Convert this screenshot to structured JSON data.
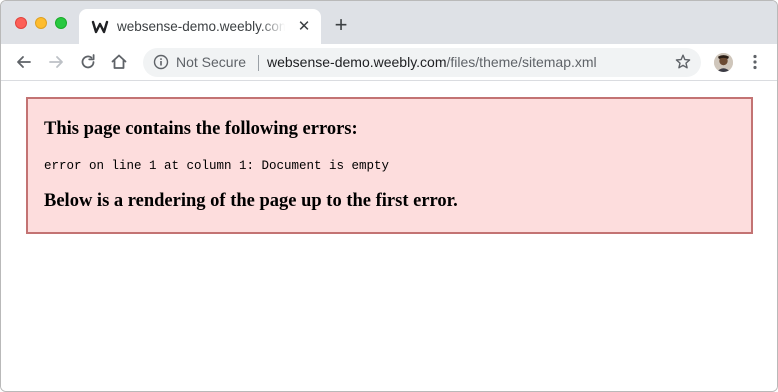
{
  "colors": {
    "tabstrip_bg": "#dee1e6",
    "close_red": "#fd5f57",
    "minimize_yellow": "#febc2e",
    "maximize_green": "#28c840",
    "error_box_bg": "#fddddd",
    "error_box_border": "#c37373"
  },
  "tab": {
    "favicon": "weebly-w-icon",
    "title": "websense-demo.weebly.com/files/theme/sitemap.xml",
    "close_glyph": "✕"
  },
  "new_tab_glyph": "+",
  "toolbar": {
    "back_icon": "back-arrow-icon",
    "forward_icon": "forward-arrow-icon",
    "reload_icon": "reload-icon",
    "home_icon": "home-icon"
  },
  "omnibox": {
    "security_label": "Not Secure",
    "url_host": "websense-demo.weebly.com",
    "url_path": "/files/theme/sitemap.xml",
    "bookmark_icon": "star-icon"
  },
  "page": {
    "error_heading": "This page contains the following errors:",
    "error_detail": "error on line 1 at column 1: Document is empty",
    "error_footer": "Below is a rendering of the page up to the first error."
  }
}
